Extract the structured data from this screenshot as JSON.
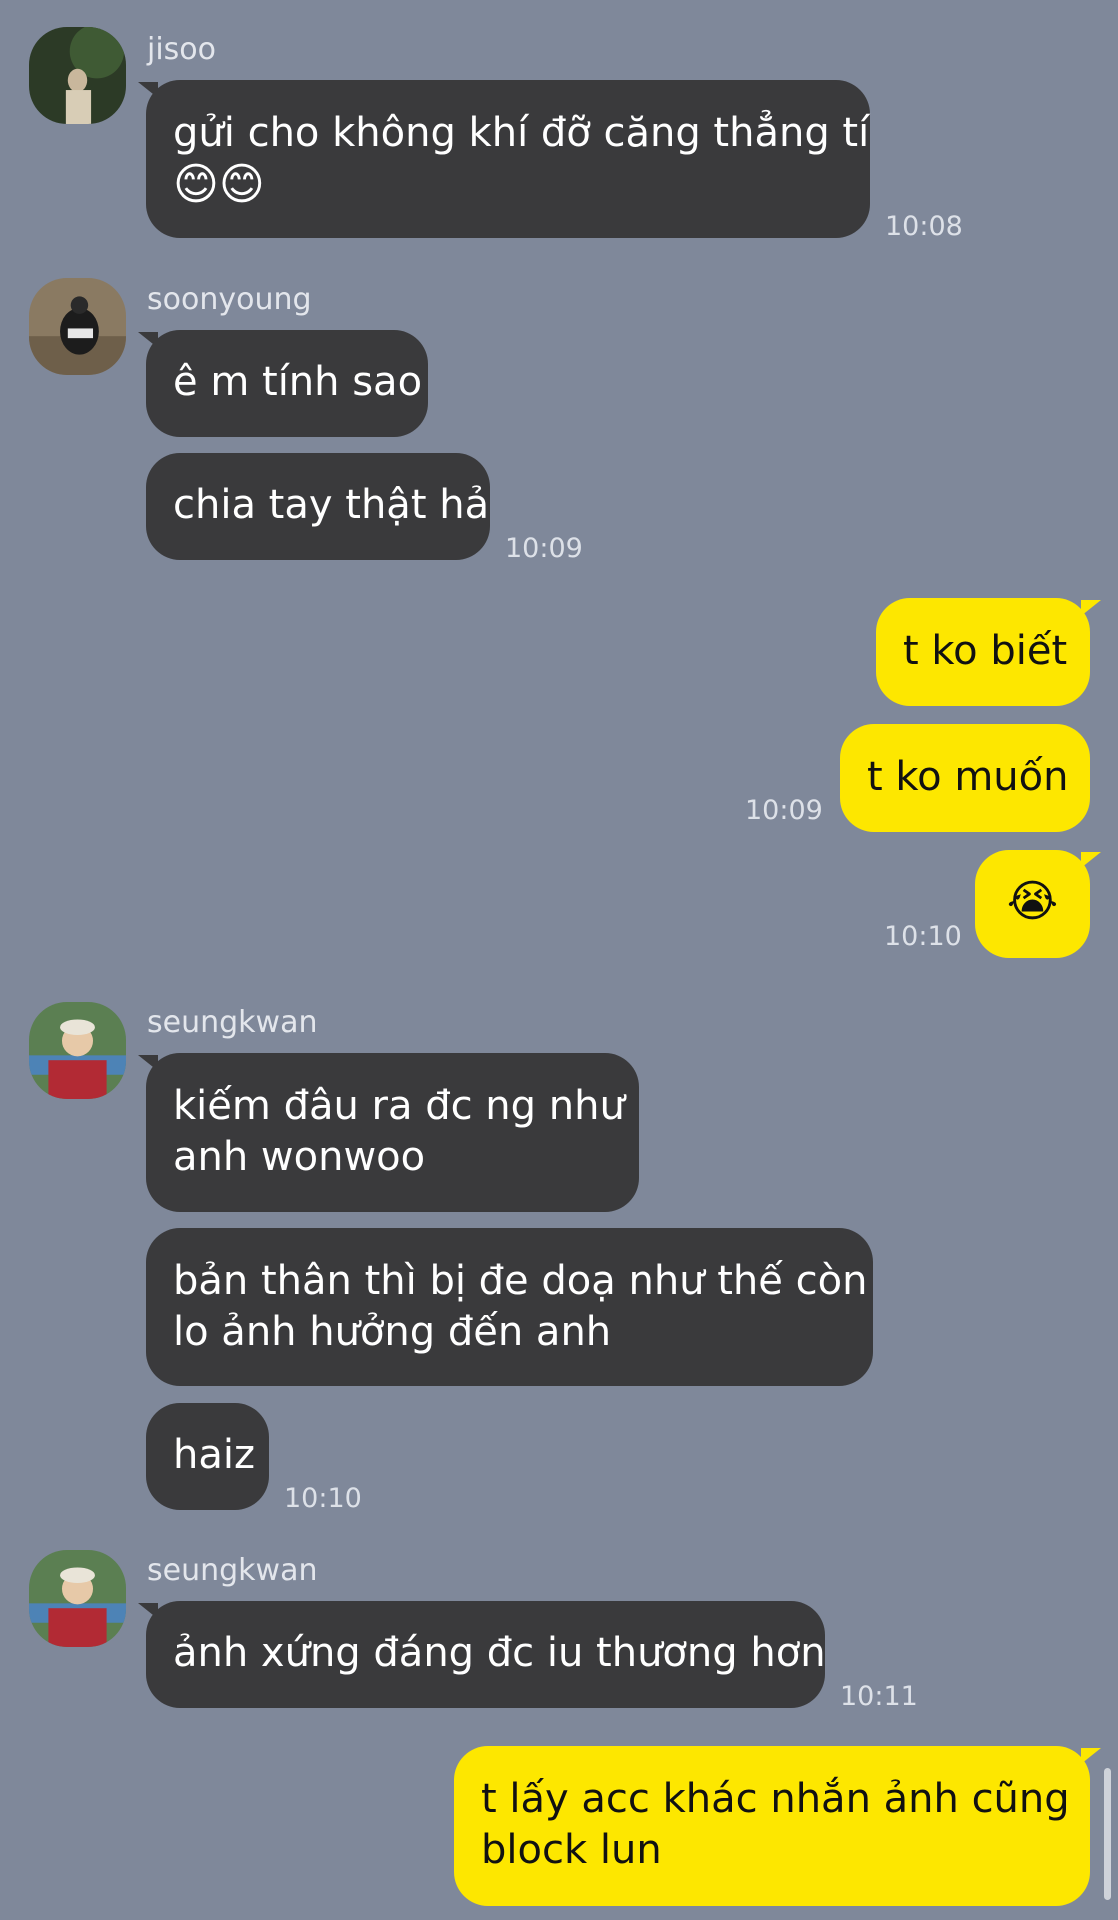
{
  "messages": [
    {
      "sender": "jisoo",
      "text_line1": "gửi cho không khí đỡ căng thẳng tí",
      "text_line2": "😊😊",
      "time": "10:08"
    },
    {
      "sender": "soonyoung",
      "text_a": "ê m tính sao",
      "text_b": "chia tay thật hả",
      "time": "10:09"
    },
    {
      "sender": "me",
      "text_a": "t ko biết",
      "text_b": "t ko muốn",
      "time_b": "10:09",
      "text_c": "😭",
      "time_c": "10:10"
    },
    {
      "sender": "seungkwan",
      "text_a_line1": "kiếm đâu ra đc ng như",
      "text_a_line2": "anh wonwoo",
      "text_b_line1": "bản thân thì bị đe doạ như thế còn",
      "text_b_line2": "lo ảnh hưởng đến anh",
      "text_c": "haiz",
      "time": "10:10"
    },
    {
      "sender": "seungkwan",
      "text": "ảnh xứng đáng đc iu thương hơn",
      "time": "10:11"
    },
    {
      "sender": "me",
      "text_line1": "t lấy acc khác nhắn ảnh cũng",
      "text_line2": "block lun"
    }
  ],
  "colors": {
    "background": "#7f889a",
    "incoming_bubble": "#3a3a3c",
    "outgoing_bubble": "#fde700"
  }
}
